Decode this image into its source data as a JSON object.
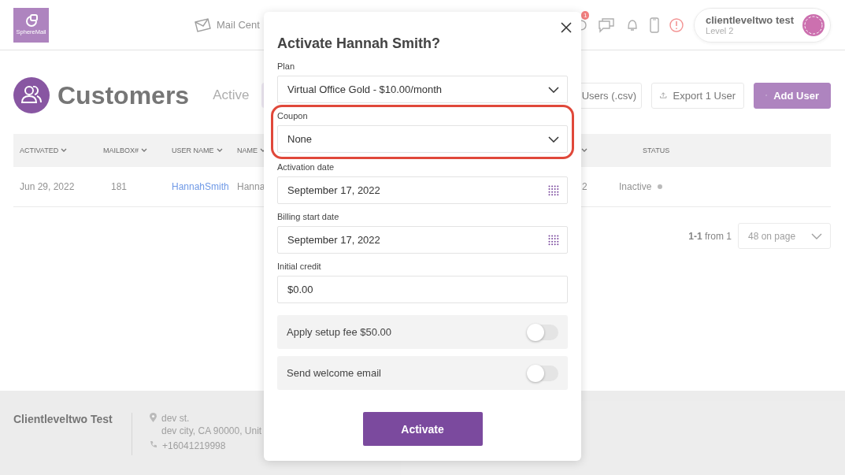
{
  "header": {
    "logo_text": "SphereMail",
    "nav_item": "Mail Cent",
    "notification_count": "1",
    "user": {
      "name": "clientleveltwo test",
      "level": "Level 2"
    }
  },
  "page": {
    "title": "Customers",
    "tab": "Active",
    "buttons": [
      {
        "label": "Users (.csv)",
        "kind": "outline"
      },
      {
        "label": "Export 1 User",
        "kind": "export"
      },
      {
        "label": "Add User",
        "kind": "primary"
      }
    ]
  },
  "table": {
    "columns": [
      {
        "label": "ACTIVATED",
        "sortable": true
      },
      {
        "label": "MAILBOX#",
        "sortable": true
      },
      {
        "label": "USER NAME",
        "sortable": true
      },
      {
        "label": "NAME",
        "sortable": true
      },
      {
        "sortable": true
      },
      {
        "label": "STATUS",
        "sortable": false
      }
    ],
    "rows": [
      {
        "cells": [
          "Jun 29, 2022",
          "181",
          "HannahSmith",
          "Hanna",
          "2",
          "Inactive"
        ]
      }
    ]
  },
  "pagination": {
    "range": "1-1",
    "total": "from 1",
    "page_size": "48 on page"
  },
  "footer": {
    "company": "Clientleveltwo Test",
    "address": [
      "dev st.",
      "dev city, CA 90000, Unit"
    ],
    "phone": "+16041219998"
  },
  "dialog": {
    "title": "Activate Hannah Smith?",
    "fields": [
      {
        "label": "Plan",
        "kind": "select",
        "value": "Virtual Office Gold - $10.00/month",
        "highlighted": false
      },
      {
        "label": "Coupon",
        "kind": "select",
        "value": "None",
        "highlighted": true
      },
      {
        "label": "Activation date",
        "kind": "date",
        "value": "September 17, 2022",
        "highlighted": false
      },
      {
        "label": "Billing start date",
        "kind": "date",
        "value": "September 17, 2022",
        "highlighted": false
      },
      {
        "label": "Initial credit",
        "kind": "text",
        "value": "$0.00",
        "highlighted": false
      }
    ],
    "toggles": [
      {
        "label": "Apply setup fee $50.00",
        "on": false
      },
      {
        "label": "Send welcome email",
        "on": false
      }
    ],
    "submit": "Activate"
  }
}
